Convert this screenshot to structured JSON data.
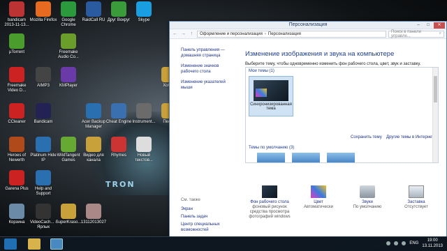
{
  "desktop": {
    "icons": [
      {
        "label": "bandicam 2013-11-13...",
        "color": "#b33"
      },
      {
        "label": "Mozilla Firefox",
        "color": "#e66a1f"
      },
      {
        "label": "Google Chrome",
        "color": "#2b9a3c"
      },
      {
        "label": "RaidCall RU",
        "color": "#2a5aa0"
      },
      {
        "label": "Друг Вокруг",
        "color": "#3a9b3a"
      },
      {
        "label": "Skype",
        "color": "#1a9ee2"
      },
      {
        "label": "µTorrent",
        "color": "#4a9d2c"
      },
      {
        "label": "Freemake Audio Co...",
        "color": "#6b9d2b"
      },
      {
        "label": "Freemake Video D...",
        "color": "#c22"
      },
      {
        "label": "AIMP3",
        "color": "#444"
      },
      {
        "label": "KMPlayer",
        "color": "#6a3aa8"
      },
      {
        "label": "CCleaner",
        "color": "#c22"
      },
      {
        "label": "Bandicam",
        "color": "#225"
      },
      {
        "label": "Acer Backup Manager",
        "color": "#2a6fb0"
      },
      {
        "label": "Cheat Engine",
        "color": "#3a6fb0"
      },
      {
        "label": "Instrument...",
        "color": "#6b6b6b"
      },
      {
        "label": "Heroes of Newerth",
        "color": "#b04a1a"
      },
      {
        "label": "Platinum Hide IP",
        "color": "#2a6fb0"
      },
      {
        "label": "WildTangent Games",
        "color": "#6a3"
      },
      {
        "label": "Видео для канала",
        "color": "#c9a13a"
      },
      {
        "label": "Rhymes",
        "color": "#c33"
      },
      {
        "label": "Новый текстов...",
        "color": "#ddd"
      },
      {
        "label": "Garena Plus",
        "color": "#c22"
      },
      {
        "label": "Help and Support",
        "color": "#2a6fb0"
      },
      {
        "label": "Корзина",
        "color": "#6a8aa8"
      },
      {
        "label": "VideoCach... - Ярлык",
        "color": "#333"
      },
      {
        "label": "SuperKraso...",
        "color": "#c9a13a"
      },
      {
        "label": "13112013027",
        "color": "#a88"
      },
      {
        "label": "Хобби",
        "color": "#c9a13a"
      },
      {
        "label": "Песни",
        "color": "#c9a13a"
      }
    ],
    "wallpaper_logo": "TRON"
  },
  "window": {
    "title": "Персонализация",
    "controls": {
      "minimize": "–",
      "maximize": "□",
      "close": "✕"
    },
    "breadcrumb": [
      "Оформление и персонализация",
      "Персонализация"
    ],
    "search_placeholder": "Поиск в панели управле...",
    "left_links": [
      "Панель управления — домашняя страница",
      "Изменение значков рабочего стола",
      "Изменение указателей мыши"
    ],
    "see_also_label": "См. также",
    "see_also": [
      "Экран",
      "Панель задач",
      "Центр специальных возможностей"
    ],
    "heading": "Изменение изображения и звука на компьютере",
    "description": "Выберите тему, чтобы одновременно изменить фон рабочего стола, цвет, звук и заставку.",
    "my_themes_label": "Мои темы (1)",
    "my_theme_name": "Синхронизированная тема",
    "save_theme": "Сохранить тему",
    "online_themes": "Другие темы в Интернете",
    "default_themes_label": "Темы по умолчанию (3)",
    "bottom": [
      {
        "title": "Фон рабочего стола",
        "sub": "фоновый рисунок средства просмотра фотографий windows"
      },
      {
        "title": "Цвет",
        "sub": "Автоматически"
      },
      {
        "title": "Звуки",
        "sub": "По умолчанию"
      },
      {
        "title": "Заставка",
        "sub": "Отсутствует"
      }
    ]
  },
  "taskbar": {
    "lang": "ENG",
    "time": "19:00",
    "date": "13.11.2013"
  }
}
